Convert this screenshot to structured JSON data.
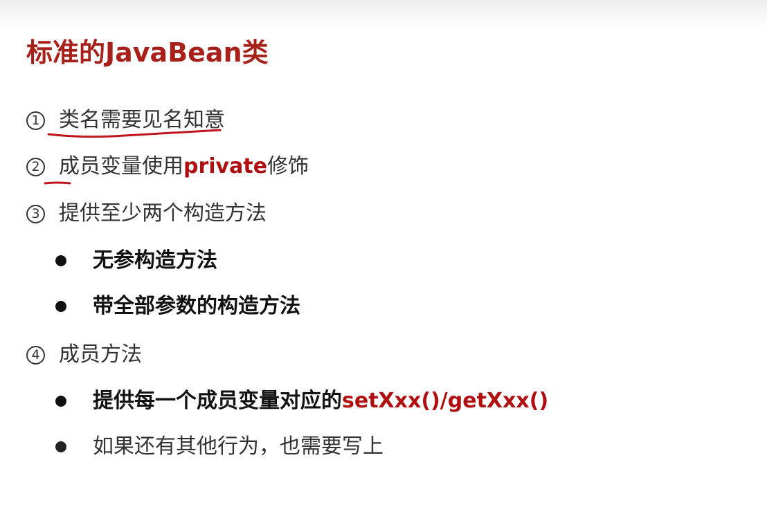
{
  "title": "标准的JavaBean类",
  "items": [
    {
      "marker": "1",
      "text": "类名需要见名知意"
    },
    {
      "marker": "2",
      "text_before": "成员变量使用",
      "keyword": "private",
      "text_after": "修饰"
    },
    {
      "marker": "3",
      "text": "提供至少两个构造方法"
    },
    {
      "marker": "4",
      "text": "成员方法"
    }
  ],
  "sub_items_3": [
    {
      "text": "无参构造方法"
    },
    {
      "text": "带全部参数的构造方法"
    }
  ],
  "sub_items_4": [
    {
      "text_before": "提供每一个成员变量对应的",
      "keyword": "setXxx()/getXxx()"
    },
    {
      "text": "如果还有其他行为，也需要写上"
    }
  ],
  "colors": {
    "title": "#a8201a",
    "keyword": "#b00f0f",
    "annotation": "#c0141c",
    "body_text": "#333333"
  },
  "icons": [
    "circled-number-1-icon",
    "circled-number-2-icon",
    "circled-number-3-icon",
    "circled-number-4-icon",
    "bullet-dot-icon"
  ]
}
